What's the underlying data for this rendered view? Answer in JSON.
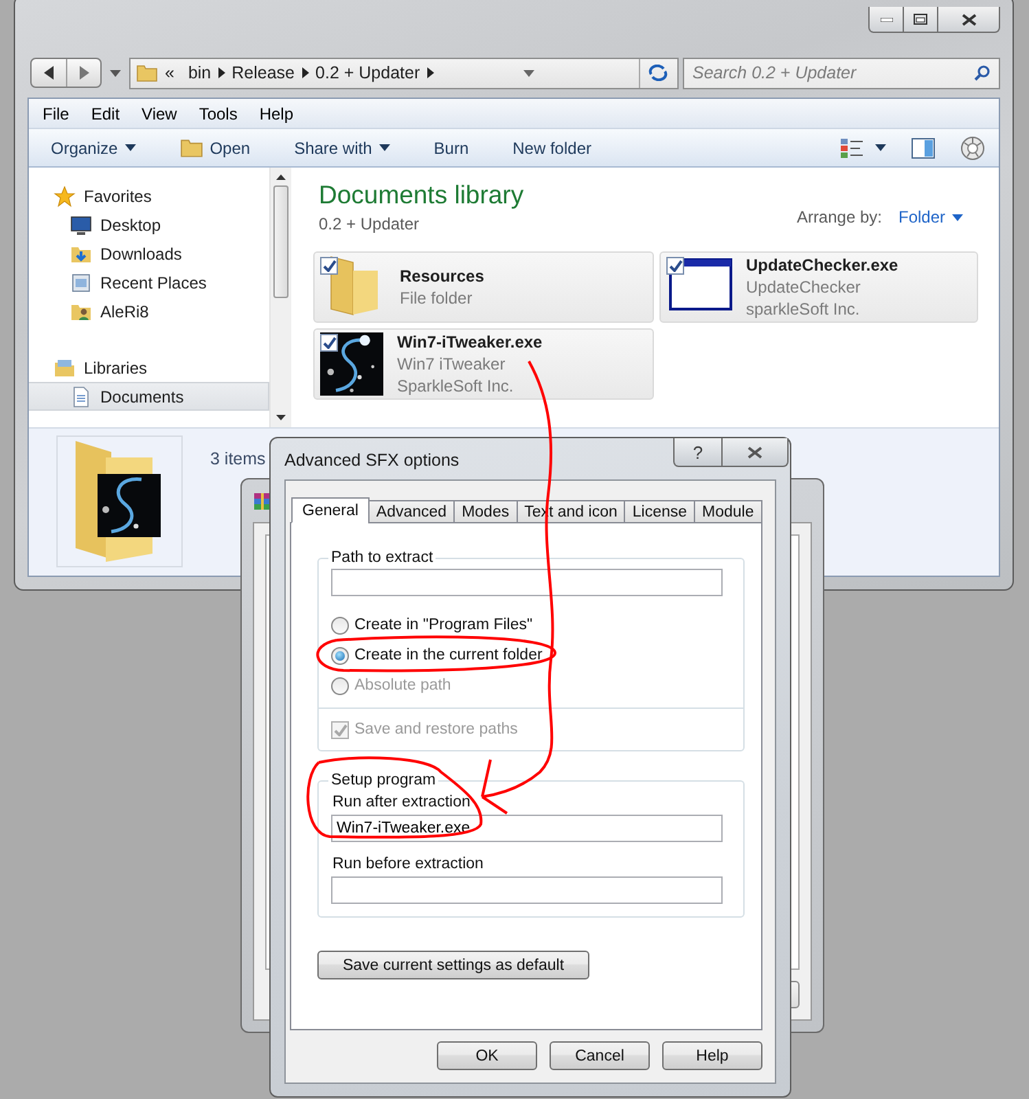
{
  "explorer": {
    "address": {
      "overflow": "«",
      "path": [
        "bin",
        "Release",
        "0.2 + Updater"
      ]
    },
    "search": {
      "placeholder": "Search 0.2 + Updater"
    },
    "menu": [
      "File",
      "Edit",
      "View",
      "Tools",
      "Help"
    ],
    "toolbar": [
      {
        "label": "Organize",
        "kind": "dropdown"
      },
      {
        "label": "Open",
        "kind": "icon"
      },
      {
        "label": "Share with",
        "kind": "dropdown"
      },
      {
        "label": "Burn",
        "kind": "plain"
      },
      {
        "label": "New folder",
        "kind": "plain"
      }
    ],
    "sidebar": [
      {
        "label": "Favorites",
        "children": [
          {
            "label": "Desktop",
            "selected": false
          },
          {
            "label": "Downloads",
            "selected": false
          },
          {
            "label": "Recent Places",
            "selected": false
          },
          {
            "label": "AleRi8",
            "selected": false
          }
        ]
      },
      {
        "label": "Libraries",
        "children": [
          {
            "label": "Documents",
            "selected": true
          }
        ]
      }
    ],
    "library": {
      "title": "Documents library",
      "subtitle": "0.2 + Updater",
      "arrange_label": "Arrange by:",
      "arrange_value": "Folder"
    },
    "files": [
      {
        "kind": "folder",
        "name": "Resources",
        "checked": true,
        "details": [
          "File folder"
        ]
      },
      {
        "kind": "window",
        "name": "UpdateChecker.exe",
        "checked": true,
        "details": [
          "UpdateChecker",
          "sparkleSoft Inc."
        ]
      },
      {
        "kind": "app",
        "name": "Win7-iTweaker.exe",
        "checked": true,
        "details": [
          "Win7 iTweaker",
          "SparkleSoft Inc."
        ]
      }
    ],
    "status": "3 items"
  },
  "dialog": {
    "title": "Advanced SFX options",
    "help_button": "?",
    "tabs": [
      {
        "label": "General",
        "selected": true
      },
      {
        "label": "Advanced",
        "selected": false
      },
      {
        "label": "Modes",
        "selected": false
      },
      {
        "label": "Text and icon",
        "selected": false
      },
      {
        "label": "License",
        "selected": false
      },
      {
        "label": "Module",
        "selected": false
      }
    ],
    "path_group": {
      "legend": "Path to extract",
      "options": [
        {
          "label": "Create in \"Program Files\"",
          "selected": false,
          "disabled": false
        },
        {
          "label": "Create in the current folder",
          "selected": true,
          "disabled": false
        },
        {
          "label": "Absolute path",
          "selected": false,
          "disabled": true
        }
      ],
      "save_paths": {
        "label": "Save and restore paths",
        "checked": true,
        "disabled": true
      }
    },
    "setup_group": {
      "legend": "Setup program",
      "fields": [
        {
          "label": "Run after extraction",
          "value": "Win7-iTweaker.exe"
        },
        {
          "label": "Run before extraction"
        }
      ]
    },
    "default_button": "Save current settings as default",
    "buttons": [
      "OK",
      "Cancel",
      "Help"
    ]
  }
}
